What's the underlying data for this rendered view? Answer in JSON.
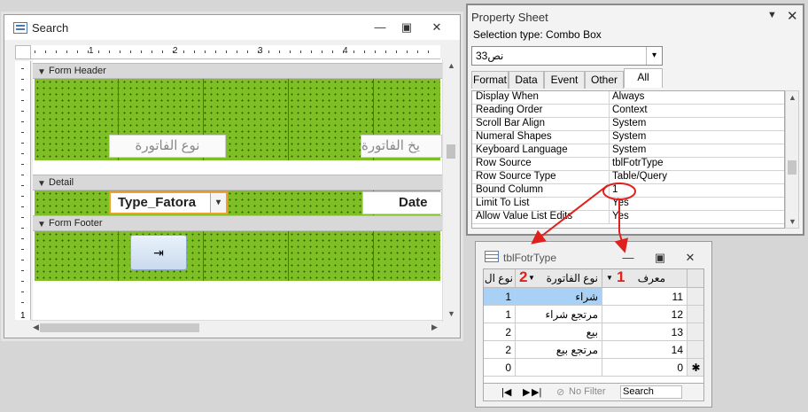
{
  "search_window": {
    "title": "Search",
    "ruler_numbers": [
      "1",
      "2",
      "3",
      "4"
    ],
    "sections": {
      "header": "Form Header",
      "detail": "Detail",
      "footer": "Form Footer"
    },
    "header_labels": [
      "نوع الفاتورة",
      "يخ الفاتورة"
    ],
    "combo_value": "Type_Fatora",
    "textbox_value": "Date",
    "vertical_ruler_number": "1",
    "button_icon": "exit-door-icon"
  },
  "property_sheet": {
    "title": "Property Sheet",
    "selection_type_label": "Selection type:  Combo Box",
    "selected_control": "نص33",
    "tabs": [
      "Format",
      "Data",
      "Event",
      "Other",
      "All"
    ],
    "active_tab": "All",
    "rows": [
      {
        "name": "Display When",
        "value": "Always"
      },
      {
        "name": "Reading Order",
        "value": "Context"
      },
      {
        "name": "Scroll Bar Align",
        "value": "System"
      },
      {
        "name": "Numeral Shapes",
        "value": "System"
      },
      {
        "name": "Keyboard Language",
        "value": "System"
      },
      {
        "name": "Row Source",
        "value": "tblFotrType"
      },
      {
        "name": "Row Source Type",
        "value": "Table/Query"
      },
      {
        "name": "Bound Column",
        "value": "1"
      },
      {
        "name": "Limit To List",
        "value": "Yes"
      },
      {
        "name": "Allow Value List Edits",
        "value": "Yes"
      }
    ]
  },
  "table_window": {
    "title": "tblFotrType",
    "columns": [
      "نوع ال",
      "نوع الفاتورة",
      "معرف"
    ],
    "annotations": [
      "2",
      "1"
    ],
    "rows": [
      {
        "c1": "1",
        "c2": "شراء",
        "c3": "11"
      },
      {
        "c1": "1",
        "c2": "مرتجع شراء",
        "c3": "12"
      },
      {
        "c1": "2",
        "c2": "بيع",
        "c3": "13"
      },
      {
        "c1": "2",
        "c2": "مرتجع بيع",
        "c3": "14"
      },
      {
        "c1": "0",
        "c2": "",
        "c3": "0"
      }
    ],
    "new_row_marker": "✱",
    "nav": {
      "filter": "No Filter",
      "search": "Search"
    }
  },
  "colors": {
    "accent_red": "#e0201c",
    "form_green": "#7fbf26",
    "selection_blue": "#a9d1f5"
  }
}
